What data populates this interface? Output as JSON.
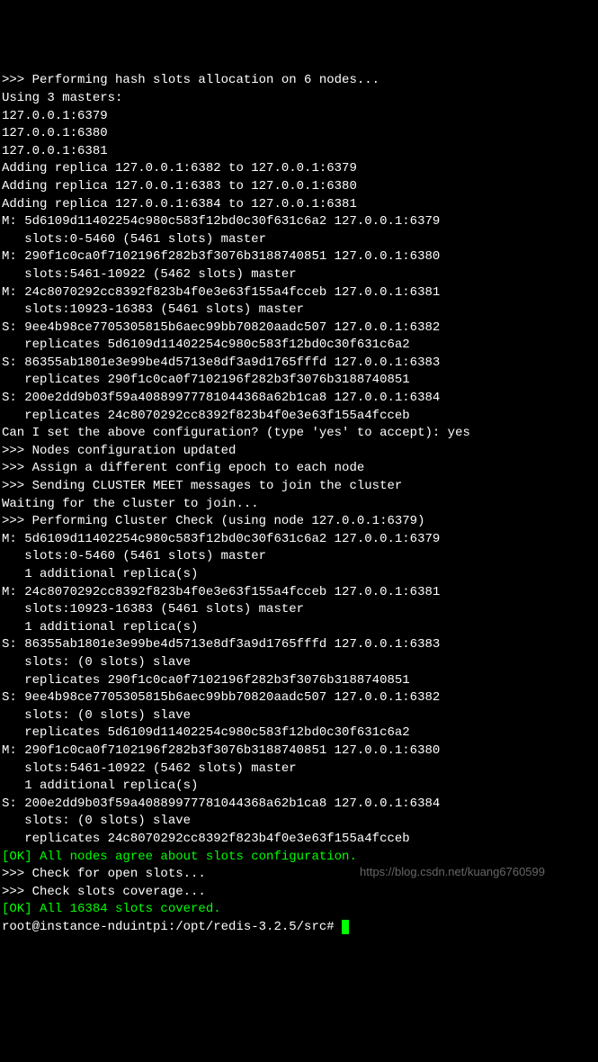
{
  "lines": [
    {
      "t": ">>> Performing hash slots allocation on 6 nodes...",
      "c": ""
    },
    {
      "t": "Using 3 masters:",
      "c": ""
    },
    {
      "t": "127.0.0.1:6379",
      "c": ""
    },
    {
      "t": "127.0.0.1:6380",
      "c": ""
    },
    {
      "t": "127.0.0.1:6381",
      "c": ""
    },
    {
      "t": "Adding replica 127.0.0.1:6382 to 127.0.0.1:6379",
      "c": ""
    },
    {
      "t": "Adding replica 127.0.0.1:6383 to 127.0.0.1:6380",
      "c": ""
    },
    {
      "t": "Adding replica 127.0.0.1:6384 to 127.0.0.1:6381",
      "c": ""
    },
    {
      "t": "M: 5d6109d11402254c980c583f12bd0c30f631c6a2 127.0.0.1:6379",
      "c": ""
    },
    {
      "t": "   slots:0-5460 (5461 slots) master",
      "c": ""
    },
    {
      "t": "M: 290f1c0ca0f7102196f282b3f3076b3188740851 127.0.0.1:6380",
      "c": ""
    },
    {
      "t": "   slots:5461-10922 (5462 slots) master",
      "c": ""
    },
    {
      "t": "M: 24c8070292cc8392f823b4f0e3e63f155a4fcceb 127.0.0.1:6381",
      "c": ""
    },
    {
      "t": "   slots:10923-16383 (5461 slots) master",
      "c": ""
    },
    {
      "t": "S: 9ee4b98ce7705305815b6aec99bb70820aadc507 127.0.0.1:6382",
      "c": ""
    },
    {
      "t": "   replicates 5d6109d11402254c980c583f12bd0c30f631c6a2",
      "c": ""
    },
    {
      "t": "S: 86355ab1801e3e99be4d5713e8df3a9d1765fffd 127.0.0.1:6383",
      "c": ""
    },
    {
      "t": "   replicates 290f1c0ca0f7102196f282b3f3076b3188740851",
      "c": ""
    },
    {
      "t": "S: 200e2dd9b03f59a40889977781044368a62b1ca8 127.0.0.1:6384",
      "c": ""
    },
    {
      "t": "   replicates 24c8070292cc8392f823b4f0e3e63f155a4fcceb",
      "c": ""
    },
    {
      "t": "Can I set the above configuration? (type 'yes' to accept): yes",
      "c": ""
    },
    {
      "t": ">>> Nodes configuration updated",
      "c": ""
    },
    {
      "t": ">>> Assign a different config epoch to each node",
      "c": ""
    },
    {
      "t": ">>> Sending CLUSTER MEET messages to join the cluster",
      "c": ""
    },
    {
      "t": "Waiting for the cluster to join...",
      "c": ""
    },
    {
      "t": ">>> Performing Cluster Check (using node 127.0.0.1:6379)",
      "c": ""
    },
    {
      "t": "M: 5d6109d11402254c980c583f12bd0c30f631c6a2 127.0.0.1:6379",
      "c": ""
    },
    {
      "t": "   slots:0-5460 (5461 slots) master",
      "c": ""
    },
    {
      "t": "   1 additional replica(s)",
      "c": ""
    },
    {
      "t": "M: 24c8070292cc8392f823b4f0e3e63f155a4fcceb 127.0.0.1:6381",
      "c": ""
    },
    {
      "t": "   slots:10923-16383 (5461 slots) master",
      "c": ""
    },
    {
      "t": "   1 additional replica(s)",
      "c": ""
    },
    {
      "t": "S: 86355ab1801e3e99be4d5713e8df3a9d1765fffd 127.0.0.1:6383",
      "c": ""
    },
    {
      "t": "   slots: (0 slots) slave",
      "c": ""
    },
    {
      "t": "   replicates 290f1c0ca0f7102196f282b3f3076b3188740851",
      "c": ""
    },
    {
      "t": "S: 9ee4b98ce7705305815b6aec99bb70820aadc507 127.0.0.1:6382",
      "c": ""
    },
    {
      "t": "   slots: (0 slots) slave",
      "c": ""
    },
    {
      "t": "   replicates 5d6109d11402254c980c583f12bd0c30f631c6a2",
      "c": ""
    },
    {
      "t": "M: 290f1c0ca0f7102196f282b3f3076b3188740851 127.0.0.1:6380",
      "c": ""
    },
    {
      "t": "   slots:5461-10922 (5462 slots) master",
      "c": ""
    },
    {
      "t": "   1 additional replica(s)",
      "c": ""
    },
    {
      "t": "S: 200e2dd9b03f59a40889977781044368a62b1ca8 127.0.0.1:6384",
      "c": ""
    },
    {
      "t": "   slots: (0 slots) slave",
      "c": ""
    },
    {
      "t": "   replicates 24c8070292cc8392f823b4f0e3e63f155a4fcceb",
      "c": ""
    },
    {
      "t": "[OK] All nodes agree about slots configuration.",
      "c": "green"
    },
    {
      "t": ">>> Check for open slots...",
      "c": ""
    },
    {
      "t": ">>> Check slots coverage...",
      "c": ""
    },
    {
      "t": "[OK] All 16384 slots covered.",
      "c": "green"
    }
  ],
  "prompt": "root@instance-nduintpi:/opt/redis-3.2.5/src# ",
  "watermark": "https://blog.csdn.net/kuang6760599"
}
